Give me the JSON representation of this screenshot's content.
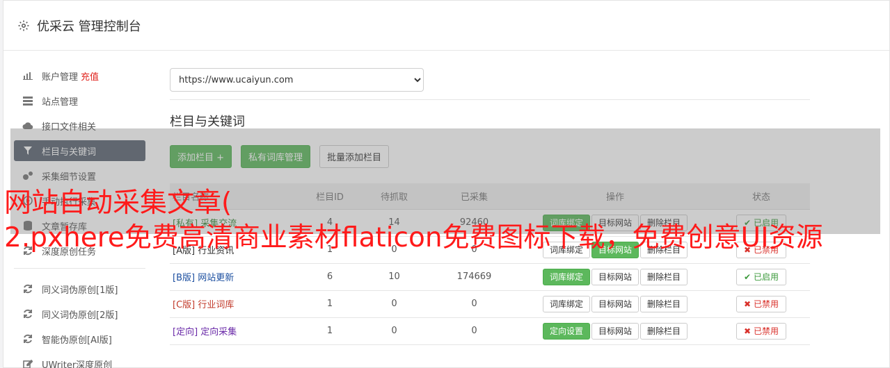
{
  "header": {
    "title": "优采云 管理控制台"
  },
  "sidebar": {
    "items": [
      {
        "label": "账户管理",
        "badge": "充值",
        "icon": "bar-chart-icon"
      },
      {
        "label": "站点管理",
        "icon": "server-icon"
      },
      {
        "label": "接口文件相关",
        "icon": "cloud-upload-icon"
      },
      {
        "label": "栏目与关键词",
        "icon": "filter-icon",
        "active": true
      },
      {
        "label": "采集细节设置",
        "icon": "gears-icon"
      },
      {
        "label": "手动执行采集",
        "icon": "play-icon"
      },
      {
        "label": "文章暂存库",
        "icon": "database-icon"
      },
      {
        "label": "深度原创任务",
        "icon": "refresh-icon"
      }
    ],
    "items2": [
      {
        "label": "同义词伪原创[1版]",
        "icon": "refresh-icon"
      },
      {
        "label": "同义词伪原创[2版]",
        "icon": "refresh-icon"
      },
      {
        "label": "智能伪原创[AI版]",
        "icon": "refresh-icon"
      },
      {
        "label": "UWriter深度原创",
        "icon": "edit-icon"
      }
    ]
  },
  "main": {
    "site_select": {
      "value": "https://www.ucaiyun.com"
    },
    "section_title": "栏目与关键词",
    "toolbar": {
      "add_column": "添加栏目 +",
      "private_lexicon": "私有词库管理",
      "batch_add": "批量添加栏目"
    },
    "table": {
      "headers": [
        "栏目名称",
        "栏目ID",
        "待抓取",
        "已采集",
        "操作",
        "状态"
      ],
      "rows": [
        {
          "tag": "[私有]",
          "name": "采集交流",
          "id": "4",
          "pending": "14",
          "collected": "92460",
          "bind": "词库绑定",
          "target": "目标网站",
          "del": "删除栏目",
          "status": "已启用",
          "on": true,
          "tagclass": "tag-private",
          "target_green": false,
          "bind_green": true
        },
        {
          "tag": "[A版]",
          "name": "行业资讯",
          "id": "1",
          "pending": "0",
          "collected": "0",
          "bind": "词库绑定",
          "target": "目标网站",
          "del": "删除栏目",
          "status": "已禁用",
          "on": false,
          "tagclass": "tag-a",
          "target_green": true,
          "bind_green": false
        },
        {
          "tag": "[B版]",
          "name": "网站更新",
          "id": "6",
          "pending": "10",
          "collected": "174669",
          "bind": "词库绑定",
          "target": "目标网站",
          "del": "删除栏目",
          "status": "已启用",
          "on": true,
          "tagclass": "tag-b",
          "target_green": false,
          "bind_green": true
        },
        {
          "tag": "[C版]",
          "name": "行业词库",
          "id": "1",
          "pending": "0",
          "collected": "0",
          "bind": "词库绑定",
          "target": "目标网站",
          "del": "删除栏目",
          "status": "已禁用",
          "on": false,
          "tagclass": "tag-c",
          "target_green": false,
          "bind_green": false
        },
        {
          "tag": "[定向]",
          "name": "定向采集",
          "id": "1",
          "pending": "0",
          "collected": "0",
          "bind": "定向设置",
          "target": "目标网站",
          "del": "删除栏目",
          "status": "已禁用",
          "on": false,
          "tagclass": "tag-dir",
          "target_green": false,
          "bind_green": true
        }
      ]
    }
  },
  "watermark": {
    "line1": "网站自动采集文章(",
    "line2": "2.pxhere免费高清商业素材flaticon免费图标下载，免费创意UI资源"
  },
  "colors": {
    "accent_green": "#5cb85c",
    "sidebar_active": "#5b6572",
    "danger": "#d9302a",
    "watermark": "#ff1a1a"
  }
}
